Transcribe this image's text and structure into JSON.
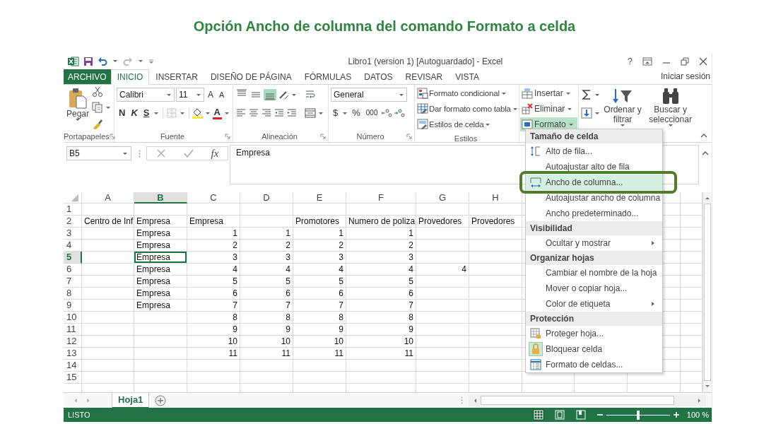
{
  "heading": "Opción Ancho de columna del comando Formato a celda",
  "window": {
    "title": "Libro1 (version 1) [Autoguardado] - Excel",
    "help": "?"
  },
  "tabs": [
    {
      "label": "ARCHIVO",
      "kind": "file",
      "selected": false
    },
    {
      "label": "INICIO",
      "kind": "tab",
      "selected": true
    },
    {
      "label": "INSERTAR",
      "kind": "tab",
      "selected": false
    },
    {
      "label": "DISEÑO DE PÁGINA",
      "kind": "tab",
      "selected": false
    },
    {
      "label": "FÓRMULAS",
      "kind": "tab",
      "selected": false
    },
    {
      "label": "DATOS",
      "kind": "tab",
      "selected": false
    },
    {
      "label": "REVISAR",
      "kind": "tab",
      "selected": false
    },
    {
      "label": "VISTA",
      "kind": "tab",
      "selected": false
    }
  ],
  "sign_in": "Iniciar sesión",
  "ribbon": [
    {
      "kind": "clipboard",
      "label": "Portapapeles",
      "paste": "Pegar"
    },
    {
      "kind": "font",
      "label": "Fuente",
      "font": "Calibri",
      "size": "11",
      "grow": "A",
      "shrink": "A",
      "bold": "N",
      "italic": "K",
      "underline": "S",
      "font_color": "A"
    },
    {
      "kind": "alignment",
      "label": "Alineación",
      "vertical": [
        {
          "selected": false
        },
        {
          "selected": false
        },
        {
          "selected": true
        }
      ]
    },
    {
      "kind": "number",
      "label": "Número",
      "format": "General",
      "currency": "$",
      "percent": "%",
      "thousands": "000"
    },
    {
      "kind": "styles",
      "label": "Estilos",
      "items": [
        "Formato condicional",
        "Dar formato como tabla",
        "Estilos de celda"
      ]
    },
    {
      "kind": "cells",
      "items": [
        {
          "label": "Insertar",
          "selected": false
        },
        {
          "label": "Eliminar",
          "selected": false
        },
        {
          "label": "Formato",
          "selected": true
        }
      ]
    },
    {
      "kind": "editing",
      "items": [
        "Ordenar y filtrar",
        "Buscar y seleccionar"
      ]
    }
  ],
  "formula_bar": {
    "name_box": "B5",
    "function_glyph": "fx",
    "value": "Empresa"
  },
  "sheet": {
    "columns": [
      {
        "label": "A",
        "selected": false
      },
      {
        "label": "B",
        "selected": true
      },
      {
        "label": "C",
        "selected": false
      },
      {
        "label": "D",
        "selected": false
      },
      {
        "label": "E",
        "selected": false
      },
      {
        "label": "F",
        "selected": false
      },
      {
        "label": "G",
        "selected": false
      },
      {
        "label": "H",
        "selected": false
      }
    ],
    "rows": [
      {
        "label": "1",
        "selected": false
      },
      {
        "label": "2",
        "selected": false,
        "cells": [
          {
            "text": "Centro de Inf",
            "kind": "text",
            "selected": false
          },
          {
            "text": "Empresa",
            "kind": "text",
            "selected": false
          },
          {
            "text": "Empresa",
            "kind": "text",
            "selected": false
          },
          null,
          {
            "text": "Promotores",
            "kind": "text",
            "selected": false
          },
          {
            "text": "Numero de poliza",
            "kind": "text",
            "selected": false
          },
          {
            "text": "Provedores",
            "kind": "text",
            "selected": false
          },
          {
            "text": "Provedores",
            "kind": "text",
            "selected": false
          }
        ]
      },
      {
        "label": "3",
        "selected": false,
        "cells": [
          null,
          {
            "text": "Empresa",
            "kind": "text",
            "selected": false
          },
          {
            "text": "1",
            "kind": "number",
            "selected": false
          },
          {
            "text": "1",
            "kind": "number",
            "selected": false
          },
          {
            "text": "1",
            "kind": "number",
            "selected": false
          },
          {
            "text": "1",
            "kind": "number",
            "selected": false
          }
        ]
      },
      {
        "label": "4",
        "selected": false,
        "cells": [
          null,
          {
            "text": "Empresa",
            "kind": "text",
            "selected": false
          },
          {
            "text": "2",
            "kind": "number",
            "selected": false
          },
          {
            "text": "2",
            "kind": "number",
            "selected": false
          },
          {
            "text": "2",
            "kind": "number",
            "selected": false
          },
          {
            "text": "2",
            "kind": "number",
            "selected": false
          }
        ]
      },
      {
        "label": "5",
        "selected": true,
        "cells": [
          null,
          {
            "text": "Empresa",
            "kind": "text",
            "selected": true
          },
          {
            "text": "3",
            "kind": "number",
            "selected": false
          },
          {
            "text": "3",
            "kind": "number",
            "selected": false
          },
          {
            "text": "3",
            "kind": "number",
            "selected": false
          },
          {
            "text": "3",
            "kind": "number",
            "selected": false
          }
        ]
      },
      {
        "label": "6",
        "selected": false,
        "cells": [
          null,
          {
            "text": "Empresa",
            "kind": "text",
            "selected": false
          },
          {
            "text": "4",
            "kind": "number",
            "selected": false
          },
          {
            "text": "4",
            "kind": "number",
            "selected": false
          },
          {
            "text": "4",
            "kind": "number",
            "selected": false
          },
          {
            "text": "4",
            "kind": "number",
            "selected": false
          },
          {
            "text": "4",
            "kind": "number",
            "selected": false
          }
        ]
      },
      {
        "label": "7",
        "selected": false,
        "cells": [
          null,
          {
            "text": "Empresa",
            "kind": "text",
            "selected": false
          },
          {
            "text": "5",
            "kind": "number",
            "selected": false
          },
          {
            "text": "5",
            "kind": "number",
            "selected": false
          },
          {
            "text": "5",
            "kind": "number",
            "selected": false
          },
          {
            "text": "5",
            "kind": "number",
            "selected": false
          }
        ]
      },
      {
        "label": "8",
        "selected": false,
        "cells": [
          null,
          {
            "text": "Empresa",
            "kind": "text",
            "selected": false
          },
          {
            "text": "6",
            "kind": "number",
            "selected": false
          },
          {
            "text": "6",
            "kind": "number",
            "selected": false
          },
          {
            "text": "6",
            "kind": "number",
            "selected": false
          },
          {
            "text": "6",
            "kind": "number",
            "selected": false
          }
        ]
      },
      {
        "label": "9",
        "selected": false,
        "cells": [
          null,
          {
            "text": "Empresa",
            "kind": "text",
            "selected": false
          },
          {
            "text": "7",
            "kind": "number",
            "selected": false
          },
          {
            "text": "7",
            "kind": "number",
            "selected": false
          },
          {
            "text": "7",
            "kind": "number",
            "selected": false
          },
          {
            "text": "7",
            "kind": "number",
            "selected": false
          }
        ]
      },
      {
        "label": "10",
        "selected": false,
        "cells": [
          null,
          null,
          {
            "text": "8",
            "kind": "number",
            "selected": false
          },
          {
            "text": "8",
            "kind": "number",
            "selected": false
          },
          {
            "text": "8",
            "kind": "number",
            "selected": false
          },
          {
            "text": "8",
            "kind": "number",
            "selected": false
          }
        ]
      },
      {
        "label": "11",
        "selected": false,
        "cells": [
          null,
          null,
          {
            "text": "9",
            "kind": "number",
            "selected": false
          },
          {
            "text": "9",
            "kind": "number",
            "selected": false
          },
          {
            "text": "9",
            "kind": "number",
            "selected": false
          },
          {
            "text": "9",
            "kind": "number",
            "selected": false
          }
        ]
      },
      {
        "label": "12",
        "selected": false,
        "cells": [
          null,
          null,
          {
            "text": "10",
            "kind": "number",
            "selected": false
          },
          {
            "text": "10",
            "kind": "number",
            "selected": false
          },
          {
            "text": "10",
            "kind": "number",
            "selected": false
          },
          {
            "text": "10",
            "kind": "number",
            "selected": false
          }
        ]
      },
      {
        "label": "13",
        "selected": false,
        "cells": [
          null,
          null,
          {
            "text": "11",
            "kind": "number",
            "selected": false
          },
          {
            "text": "11",
            "kind": "number",
            "selected": false
          },
          {
            "text": "11",
            "kind": "number",
            "selected": false
          },
          {
            "text": "11",
            "kind": "number",
            "selected": false
          }
        ]
      },
      {
        "label": "14",
        "selected": false
      },
      {
        "label": "15",
        "selected": false
      }
    ]
  },
  "sheet_tabs": [
    {
      "label": "Hoja1",
      "selected": true
    }
  ],
  "status": {
    "text": "LISTO",
    "views": [
      {
        "selected": true
      },
      {
        "selected": false
      },
      {
        "selected": false
      }
    ],
    "zoom_slider": {
      "level": 0.5
    },
    "zoom": "100 %"
  },
  "format_menu": {
    "sections": [
      {
        "header": "Tamaño de celda",
        "items": [
          {
            "label": "Alto de fila...",
            "kind": "rowheight",
            "selected": false
          },
          {
            "label": "Autoajustar alto de fila",
            "kind": "plain",
            "selected": false
          },
          {
            "label": "Ancho de columna...",
            "kind": "colwidth",
            "selected": true
          },
          {
            "label": "Autoajustar ancho de columna",
            "kind": "plain",
            "selected": false
          },
          {
            "label": "Ancho predeterminado...",
            "kind": "plain",
            "selected": false
          }
        ]
      },
      {
        "header": "Visibilidad",
        "items": [
          {
            "label": "Ocultar y mostrar",
            "kind": "submenu",
            "selected": false
          }
        ]
      },
      {
        "header": "Organizar hojas",
        "items": [
          {
            "label": "Cambiar el nombre de la hoja",
            "kind": "plain",
            "selected": false
          },
          {
            "label": "Mover o copiar hoja...",
            "kind": "plain",
            "selected": false
          },
          {
            "label": "Color de etiqueta",
            "kind": "submenu",
            "selected": false
          }
        ]
      },
      {
        "header": "Protección",
        "items": [
          {
            "label": "Proteger hoja...",
            "kind": "protect",
            "selected": false,
            "checked": false
          },
          {
            "label": "Bloquear celda",
            "kind": "lock",
            "selected": false,
            "checked": true
          },
          {
            "label": "Formato de celdas...",
            "kind": "format",
            "selected": false,
            "checked": false
          }
        ]
      }
    ]
  }
}
